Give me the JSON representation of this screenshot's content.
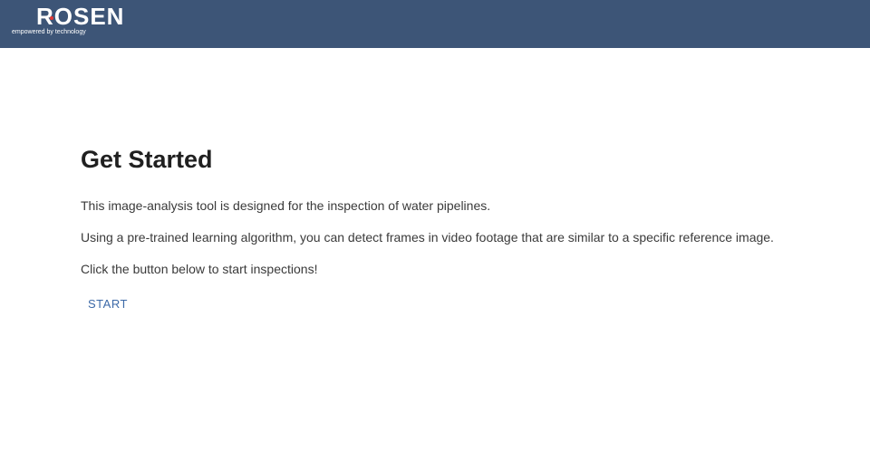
{
  "header": {
    "logo_text": "ROSEN",
    "logo_tagline": "empowered by technology",
    "background_color": "#3d5577",
    "logo_dot_color": "#e53935"
  },
  "main": {
    "title": "Get Started",
    "paragraphs": [
      "This image-analysis tool is designed for the inspection of water pipelines.",
      "Using a pre-trained learning algorithm, you can detect frames in video footage that are similar to a specific reference image.",
      "Click the button below to start inspections!"
    ],
    "start_button_label": "START",
    "accent_color": "#3d6aa8"
  }
}
